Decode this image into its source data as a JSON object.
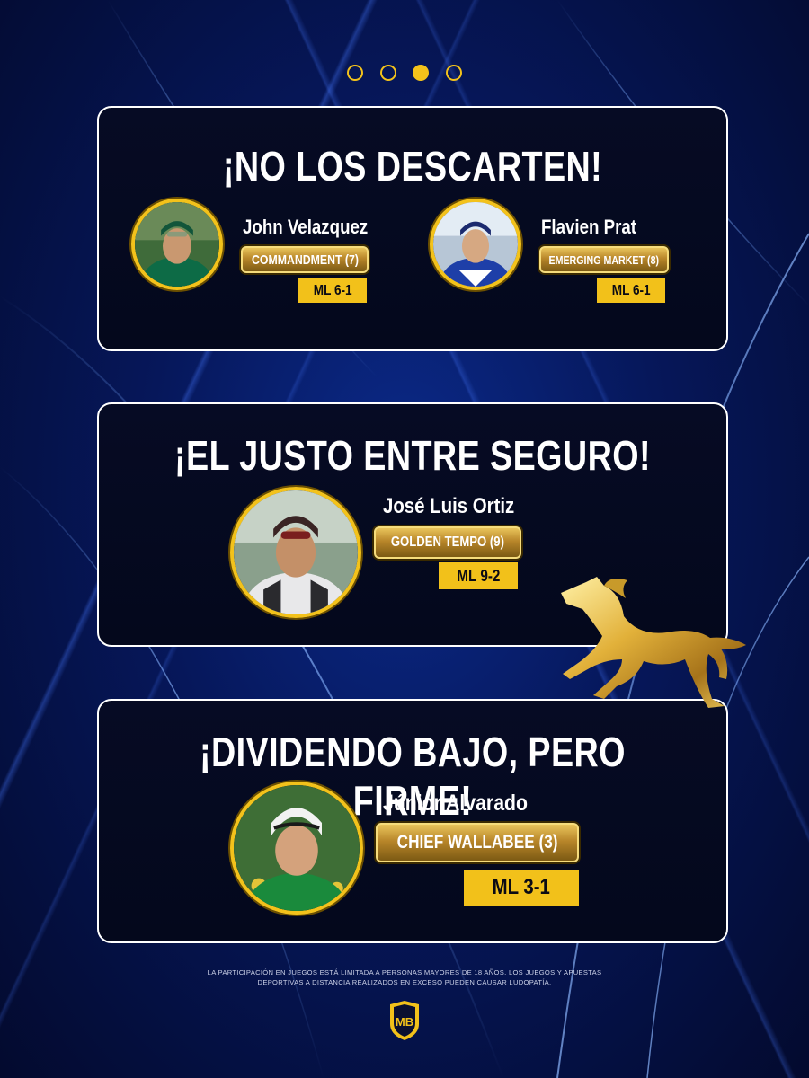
{
  "carousel": {
    "total": 4,
    "active_index": 2
  },
  "sections": [
    {
      "title": "¡NO LOS DESCARTEN!",
      "picks": [
        {
          "jockey": "John Velazquez",
          "horse": "COMMANDMENT (7)",
          "odds": "ML 6-1"
        },
        {
          "jockey": "Flavien Prat",
          "horse": "EMERGING MARKET (8)",
          "odds": "ML 6-1"
        }
      ]
    },
    {
      "title": "¡EL JUSTO ENTRE SEGURO!",
      "picks": [
        {
          "jockey": "José Luis Ortiz",
          "horse": "GOLDEN TEMPO (9)",
          "odds": "ML 9-2"
        }
      ]
    },
    {
      "title": "¡DIVIDENDO BAJO, PERO FIRME!",
      "picks": [
        {
          "jockey": "Júnior Alvarado",
          "horse": "CHIEF WALLABEE (3)",
          "odds": "ML 3-1"
        }
      ]
    }
  ],
  "disclaimer": "LA PARTICIPACIÓN EN JUEGOS ESTÁ LIMITADA A PERSONAS MAYORES DE 18 AÑOS. LOS JUEGOS Y APUESTAS DEPORTIVAS A DISTANCIA REALIZADOS EN EXCESO PUEDEN CAUSAR LUDOPATÍA.",
  "logo": {
    "text": "MB"
  },
  "colors": {
    "accent": "#f2c11a",
    "card_border": "#ffffff",
    "background": "#06175a"
  }
}
